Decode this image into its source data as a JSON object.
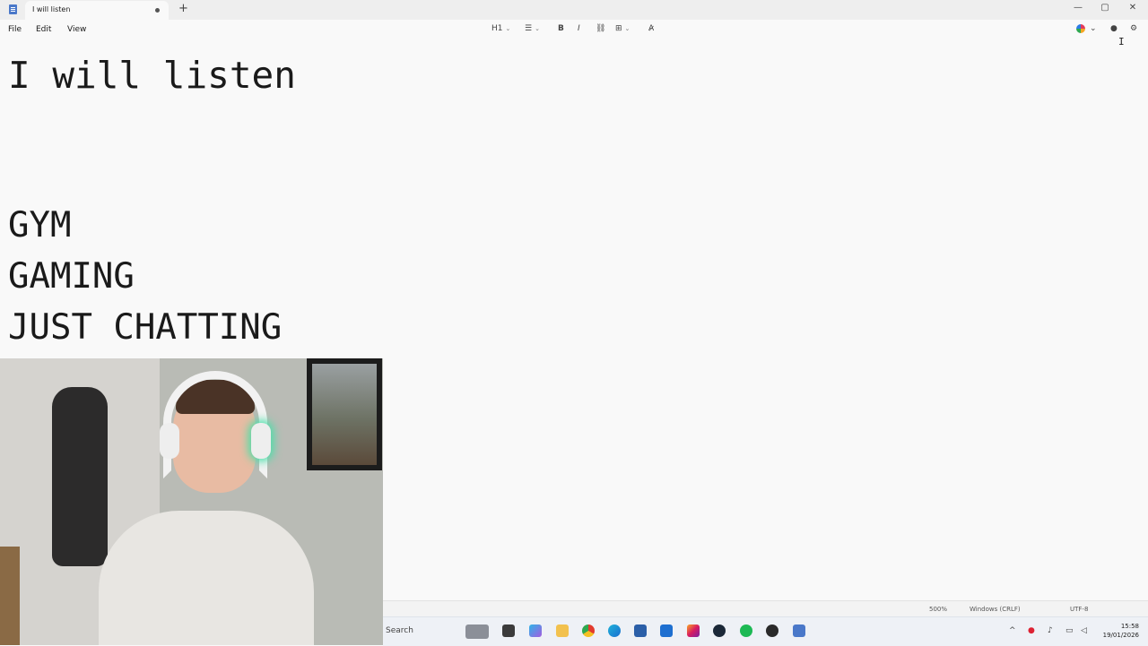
{
  "tab": {
    "title": "I will listen",
    "new_tab": "+"
  },
  "window_controls": {
    "minimize": "—",
    "maximize": "▢",
    "close": "✕"
  },
  "menu": {
    "file": "File",
    "edit": "Edit",
    "view": "View"
  },
  "toolbar": {
    "heading": "H1",
    "list": "☰",
    "bold": "B",
    "italic": "I",
    "link": "⛓",
    "table": "⊞",
    "clear_format": "A̷",
    "chevron": "⌄"
  },
  "document": {
    "heading": "I will listen",
    "lines": [
      "GYM",
      "GAMING",
      "JUST CHATTING"
    ]
  },
  "status": {
    "zoom": "500%",
    "line_ending": "Windows (CRLF)",
    "encoding": "UTF-8"
  },
  "taskbar": {
    "search_label": "Search",
    "clock_time": "15:58",
    "clock_date": "19/01/2026"
  },
  "colors": {
    "accent": "#4a78c9",
    "background": "#f9f9f9",
    "titlebar": "#eeeeee"
  }
}
